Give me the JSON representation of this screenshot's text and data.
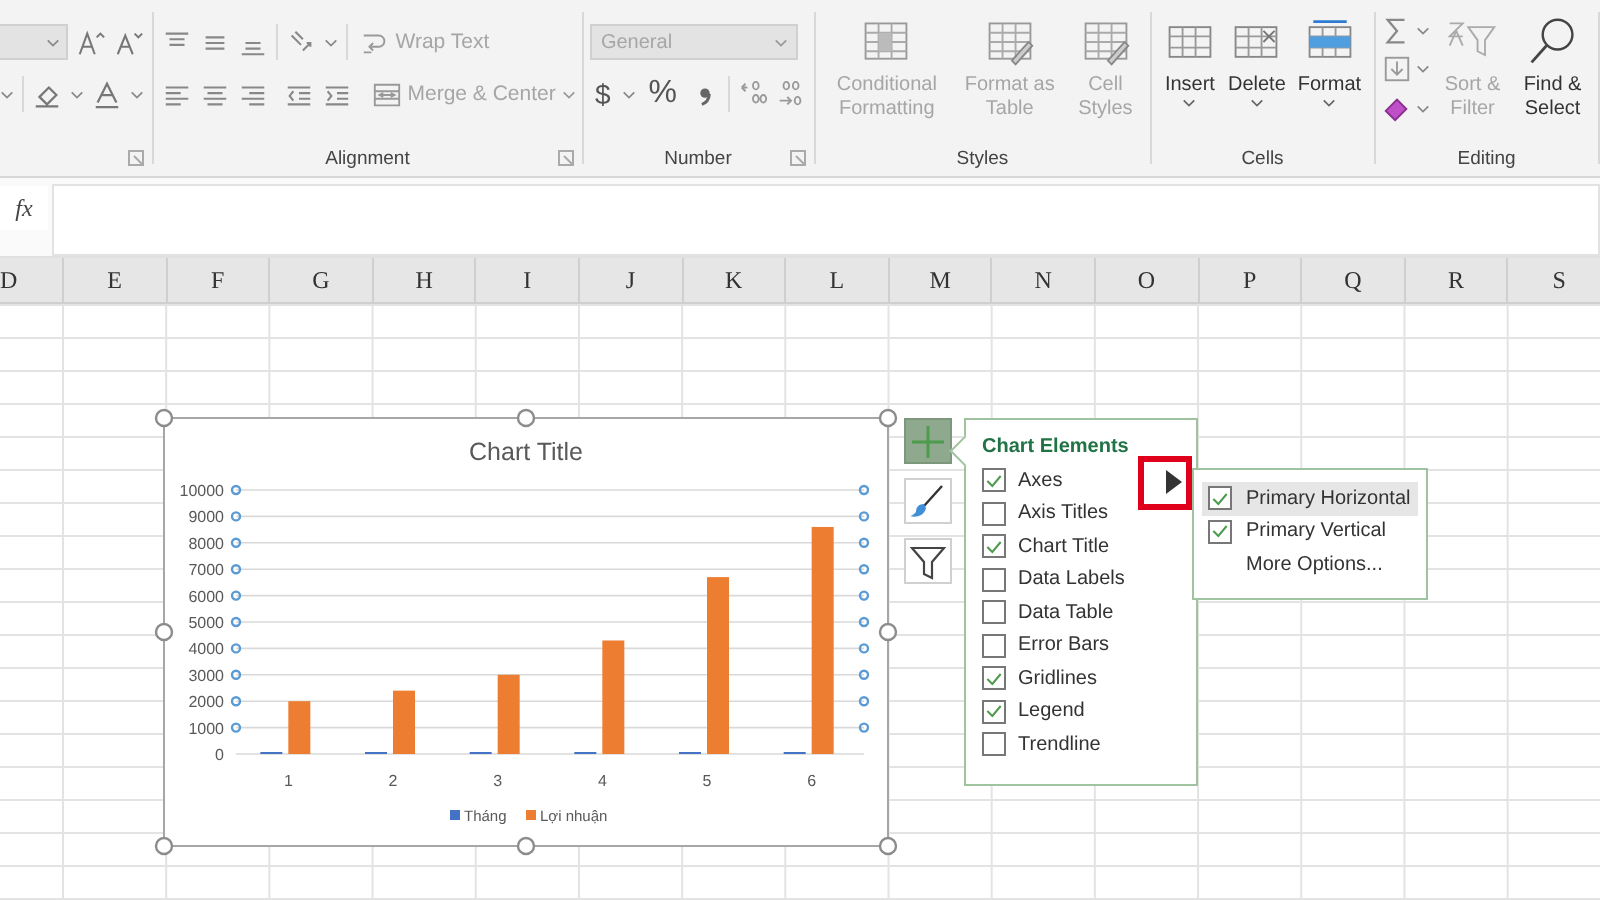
{
  "ribbon": {
    "alignment": {
      "label": "Alignment",
      "wrap_text": {
        "label": "Wrap Text",
        "disabled": true
      },
      "merge_center": {
        "label": "Merge & Center",
        "disabled": true
      }
    },
    "number": {
      "label": "Number",
      "format": {
        "value": "General",
        "disabled": true
      },
      "currency": "$",
      "percent": "%"
    },
    "styles": {
      "label": "Styles",
      "buttons": [
        {
          "label": "Conditional Formatting",
          "disabled": true
        },
        {
          "label": "Format as Table",
          "disabled": true
        },
        {
          "label": "Cell Styles",
          "disabled": true
        }
      ]
    },
    "cells": {
      "label": "Cells",
      "buttons": [
        {
          "label": "Insert",
          "disabled": false
        },
        {
          "label": "Delete",
          "disabled": false
        },
        {
          "label": "Format",
          "disabled": false
        }
      ]
    },
    "editing": {
      "label": "Editing",
      "buttons": [
        {
          "label": "Sort & Filter",
          "disabled": true
        },
        {
          "label": "Find & Select",
          "disabled": false
        }
      ]
    }
  },
  "formula_bar": {
    "function_label": "fx"
  },
  "columns": [
    "D",
    "E",
    "F",
    "G",
    "H",
    "I",
    "J",
    "K",
    "L",
    "M",
    "N",
    "O",
    "P",
    "Q",
    "R",
    "S"
  ],
  "chart": {
    "chart_data": {
      "type": "bar",
      "title": "Chart Title",
      "categories": [
        "1",
        "2",
        "3",
        "4",
        "5",
        "6"
      ],
      "series": [
        {
          "name": "Tháng",
          "color": "#4472c4",
          "values": [
            0,
            0,
            0,
            0,
            0,
            0
          ]
        },
        {
          "name": "Lợi nhuận",
          "color": "#ed7d31",
          "values": [
            2000,
            2400,
            3000,
            4300,
            6700,
            8600
          ]
        }
      ],
      "grid": true,
      "legend": "bottom",
      "ylim": [
        0,
        10000
      ],
      "yticks": [
        0,
        1000,
        2000,
        3000,
        4000,
        5000,
        6000,
        7000,
        8000,
        9000,
        10000
      ]
    }
  },
  "chart_elements": {
    "title": "Chart Elements",
    "highlight_arrow": true,
    "items": [
      {
        "label": "Axes",
        "checked": true,
        "expanded": true
      },
      {
        "label": "Axis Titles",
        "checked": false,
        "expanded": false
      },
      {
        "label": "Chart Title",
        "checked": true,
        "expanded": false
      },
      {
        "label": "Data Labels",
        "checked": false,
        "expanded": false
      },
      {
        "label": "Data Table",
        "checked": false,
        "expanded": false
      },
      {
        "label": "Error Bars",
        "checked": false,
        "expanded": false
      },
      {
        "label": "Gridlines",
        "checked": true,
        "expanded": false
      },
      {
        "label": "Legend",
        "checked": true,
        "expanded": false
      },
      {
        "label": "Trendline",
        "checked": false,
        "expanded": false
      }
    ],
    "submenu": [
      {
        "kind": "checkbox",
        "label": "Primary Horizontal",
        "checked": true,
        "selected": true
      },
      {
        "kind": "checkbox",
        "label": "Primary Vertical",
        "checked": true,
        "selected": false
      },
      {
        "kind": "command",
        "label": "More Options...",
        "selected": false
      }
    ]
  }
}
